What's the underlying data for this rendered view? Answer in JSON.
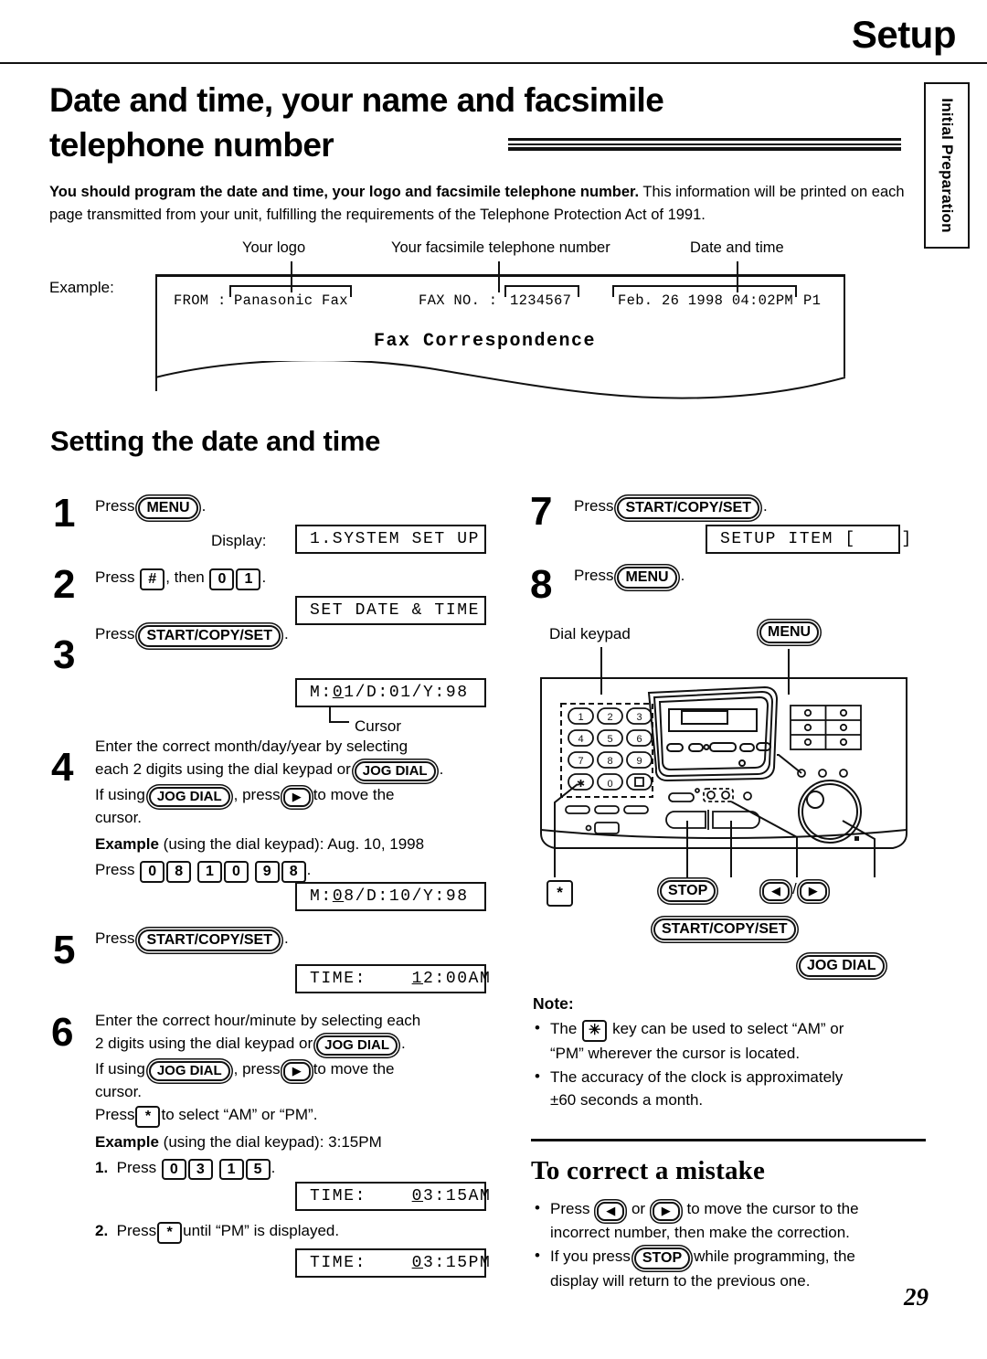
{
  "header": {
    "section_title": "Setup",
    "side_tab": "Initial Preparation",
    "page_number": "29"
  },
  "heading": {
    "line1": "Date and time, your name and facsimile",
    "line2": "telephone number"
  },
  "intro": {
    "bold_part": "You should program the date and time, your logo and facsimile telephone number.",
    "rest": " This information will be printed on each page transmitted from your unit, fulfilling the requirements of the Telephone Protection Act of 1991."
  },
  "example": {
    "label": "Example:",
    "callouts": {
      "logo": "Your logo",
      "fax_number": "Your facsimile telephone number",
      "date_time": "Date and time"
    },
    "fax_header": {
      "from_label": "FROM :",
      "from_value": "Panasonic Fax",
      "faxno_label": "FAX NO. :",
      "faxno_value": "1234567",
      "datetime_value": "Feb. 26 1998 04:02PM",
      "page_marker": "P1"
    },
    "body_text": "Fax Correspondence"
  },
  "sections": {
    "setting": "Setting the date and time",
    "correct": "To correct a mistake",
    "note_head": "Note:"
  },
  "steps": [
    {
      "num": "1",
      "text_pre": "Press",
      "key": "MENU",
      "text_post": ".",
      "display_label": "Display:",
      "display": "1.SYSTEM SET UP"
    },
    {
      "num": "2",
      "text_pre": "Press",
      "key_hash": "#",
      "text_mid": ", then",
      "key_0": "0",
      "key_1": "1",
      "text_post": ".",
      "display": "SET DATE & TIME"
    },
    {
      "num": "3",
      "text_pre": "Press",
      "key": "START/COPY/SET",
      "text_post": ".",
      "display_pre": "M:",
      "display_cursor": "0",
      "display_post": "1/D:01/Y:98",
      "cursor_label": "Cursor"
    },
    {
      "num": "4",
      "line1a": "Enter the correct month/day/year by selecting",
      "line1b": "each 2 digits using the dial keypad or",
      "key_jog": "JOG DIAL",
      "line2a": "If using",
      "line2b": ", press",
      "line2c": "to move the",
      "line3": "cursor.",
      "example_bold": "Example",
      "example_rest": "(using the dial keypad):  Aug. 10, 1998",
      "press_label": "Press",
      "press_keys": [
        "0",
        "8",
        "1",
        "0",
        "9",
        "8"
      ],
      "display_pre": "M:",
      "display_cursor": "0",
      "display_post": "8/D:10/Y:98"
    },
    {
      "num": "5",
      "text_pre": "Press",
      "key": "START/COPY/SET",
      "text_post": ".",
      "display_pre": "TIME:    ",
      "display_cursor": "1",
      "display_post": "2:00AM"
    },
    {
      "num": "6",
      "line1a": "Enter the correct hour/minute by selecting each",
      "line1b": "2 digits using the dial keypad or",
      "key_jog": "JOG DIAL",
      "line2a": "If using",
      "line2b": ", press",
      "line2c": "to move the",
      "line3": "cursor.",
      "line4a": "Press",
      "line4b": "to select “AM” or “PM”.",
      "example_bold": "Example",
      "example_rest": "(using the dial keypad):  3:15PM",
      "sub1_num": "1.",
      "sub1_label": "Press",
      "sub1_keys": [
        "0",
        "3",
        "1",
        "5"
      ],
      "display1_pre": "TIME:    ",
      "display1_cursor": "0",
      "display1_post": "3:15AM",
      "sub2_num": "2.",
      "sub2_a": "Press",
      "sub2_b": "until “PM” is displayed.",
      "display2_pre": "TIME:    ",
      "display2_cursor": "0",
      "display2_post": "3:15PM"
    },
    {
      "num": "7",
      "text_pre": "Press",
      "key": "START/COPY/SET",
      "text_post": ".",
      "display": "SETUP ITEM [    ]"
    },
    {
      "num": "8",
      "text_pre": "Press",
      "key": "MENU",
      "text_post": "."
    }
  ],
  "machine": {
    "callouts": {
      "dial_keypad": "Dial keypad",
      "menu": "MENU",
      "star": "*",
      "stop": "STOP",
      "arrows_left": "◀",
      "arrows_sep": "/",
      "arrows_right": "▶",
      "start_copy_set": "START/COPY/SET",
      "jog_dial": "JOG DIAL"
    },
    "keypad_keys": [
      "1",
      "2",
      "3",
      "4",
      "5",
      "6",
      "7",
      "8",
      "9",
      "✳",
      "0",
      "□"
    ]
  },
  "note_bullets": [
    {
      "a": "The",
      "key": "✳",
      "b": "key can be used to select “AM” or",
      "c": "“PM” wherever the cursor is located."
    },
    {
      "a": "The accuracy of the clock is approximately",
      "c": "±60 seconds a month."
    }
  ],
  "correct_bullets": [
    {
      "a": "Press",
      "k1": "◀",
      "b": "or",
      "k2": "▶",
      "c": "to move the cursor to the",
      "d": "incorrect number, then make the correction."
    },
    {
      "a": "If you press",
      "k1": "STOP",
      "c": "while programming, the",
      "d": "display will return to the previous one."
    }
  ]
}
